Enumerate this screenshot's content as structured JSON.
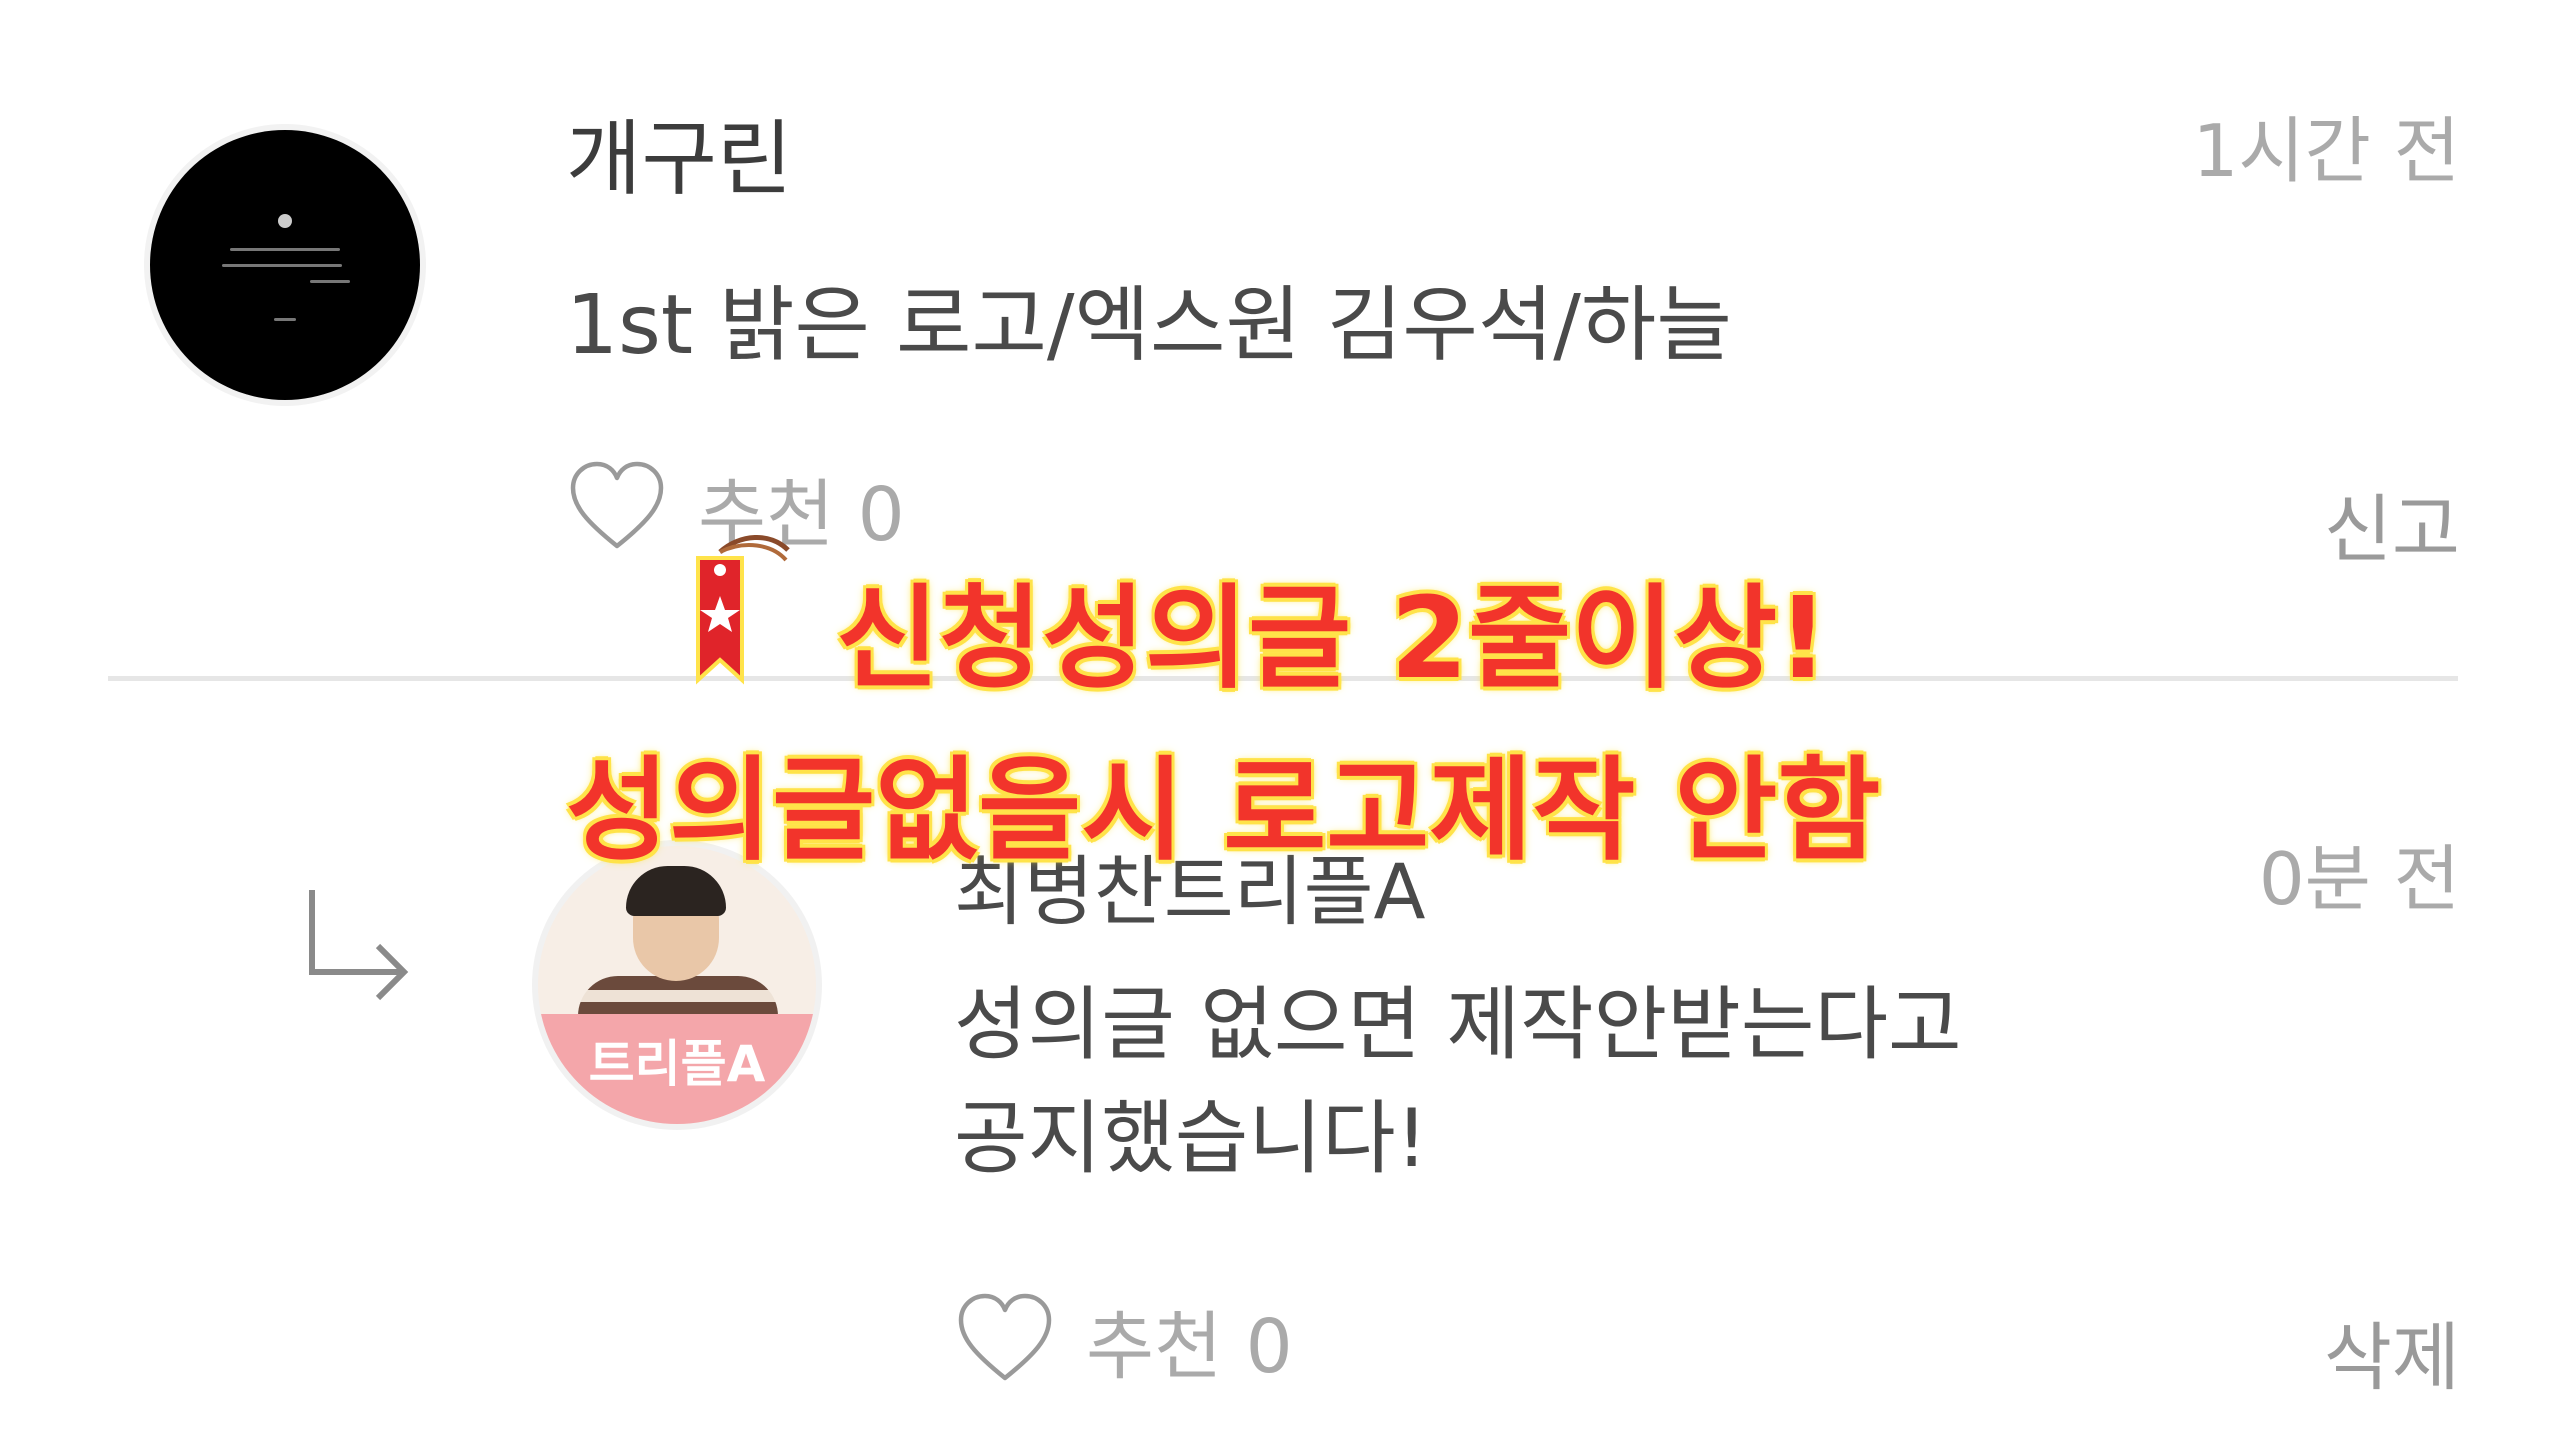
{
  "comment": {
    "author": "개구린",
    "time": "1시간 전",
    "body": "1st 밝은 로고/엑스원 김우석/하늘",
    "like_label": "추천 0",
    "report_label": "신고"
  },
  "overlay": {
    "line1": "신청성의글 2줄이상!",
    "line2": "성의글없을시 로고제작 안함"
  },
  "reply": {
    "author": "최병찬트리플A",
    "time": "0분 전",
    "body_lines": [
      "성의글 없으면 제작안받는다고",
      "공지했습니다!"
    ],
    "avatar_text": "트리플A",
    "like_label": "추천 0",
    "delete_label": "삭제"
  },
  "icons": {
    "like": "heart-outline-icon",
    "reply_indicator": "reply-arrow-icon",
    "sticker": "bookmark-tag-icon"
  },
  "colors": {
    "overlay_text": "#f2342b",
    "overlay_outline": "#ffe34a",
    "muted": "#aaaaaa"
  }
}
